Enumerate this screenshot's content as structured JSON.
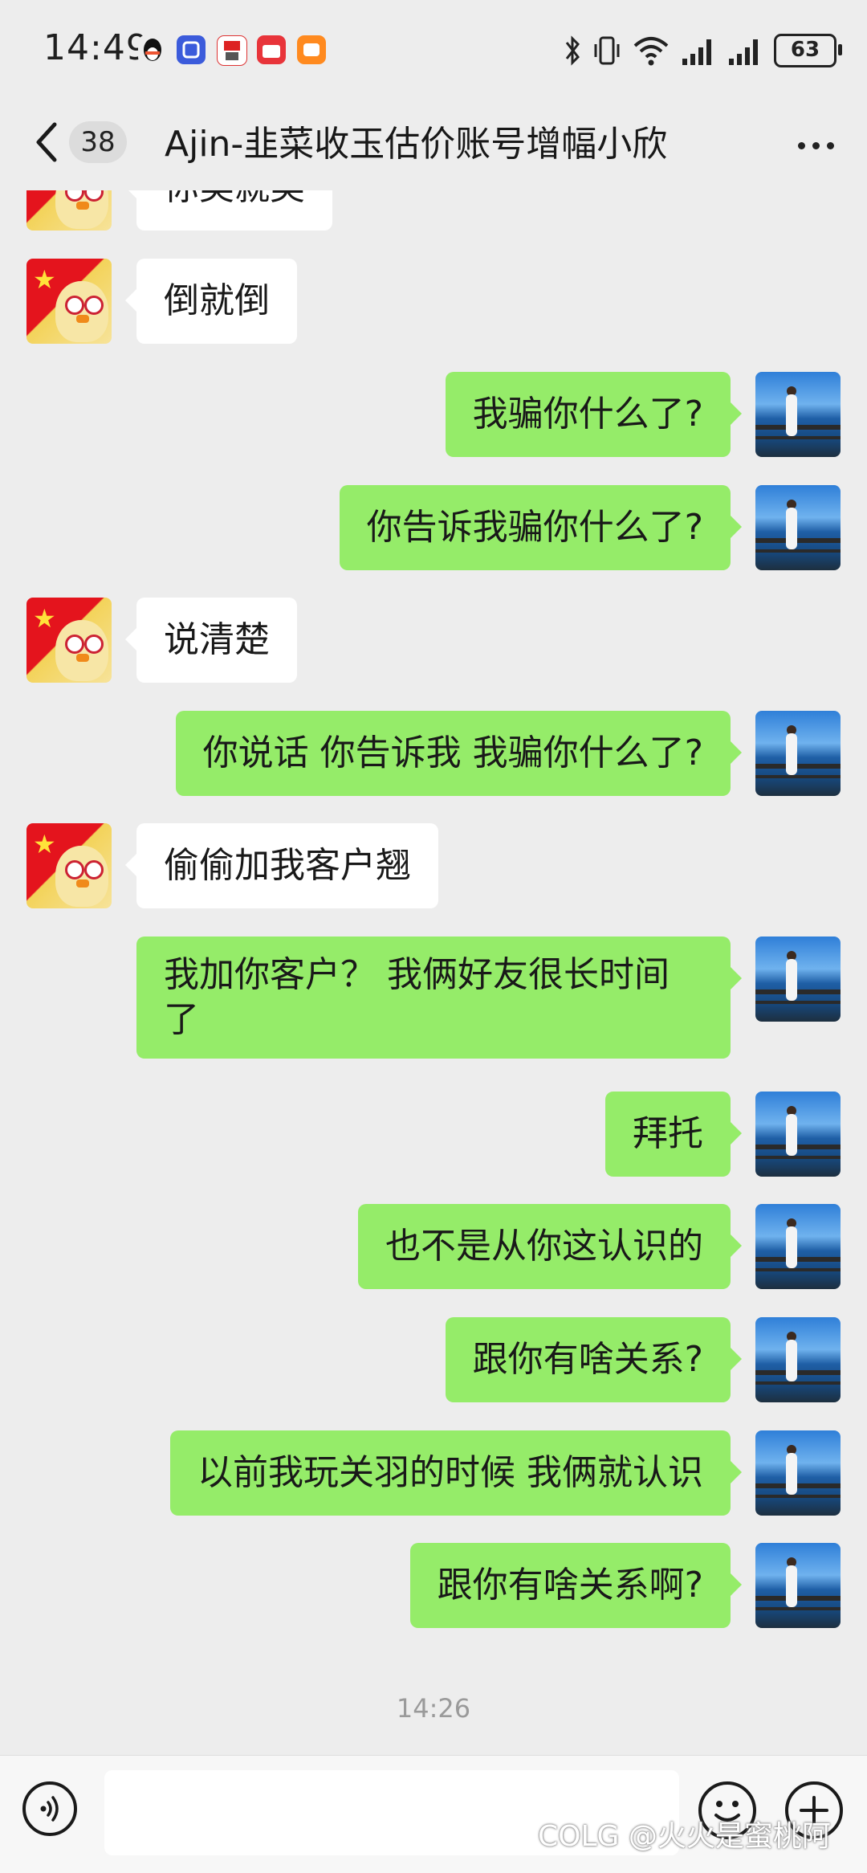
{
  "status_bar": {
    "time": "14:49",
    "battery": "63",
    "app_icons": [
      "qq-icon",
      "tieba-icon",
      "kfc-coffee-icon",
      "waimai-icon",
      "orange-app-icon"
    ],
    "right_icons": [
      "bluetooth-icon",
      "vibrate-icon",
      "wifi-icon",
      "signal-icon",
      "signal-icon"
    ]
  },
  "header": {
    "unread_count": "38",
    "title": "Ajin-韭菜收玉估价账号增幅小欣"
  },
  "messages": [
    {
      "side": "left",
      "text": "你美就美"
    },
    {
      "side": "left",
      "text": "倒就倒"
    },
    {
      "side": "right",
      "text": "我骗你什么了?"
    },
    {
      "side": "right",
      "text": "你告诉我骗你什么了?"
    },
    {
      "side": "left",
      "text": "说清楚"
    },
    {
      "side": "right",
      "text": "你说话 你告诉我 我骗你什么了?"
    },
    {
      "side": "left",
      "text": "偷偷加我客户翘"
    },
    {
      "side": "right",
      "text": "我加你客户？ 我俩好友很长时间了"
    },
    {
      "side": "right",
      "text": "拜托"
    },
    {
      "side": "right",
      "text": "也不是从你这认识的"
    },
    {
      "side": "right",
      "text": "跟你有啥关系?"
    },
    {
      "side": "right",
      "text": "以前我玩关羽的时候 我俩就认识"
    },
    {
      "side": "right",
      "text": "跟你有啥关系啊?"
    }
  ],
  "timestamp": "14:26",
  "input": {
    "value": ""
  },
  "colors": {
    "background": "#ededed",
    "sent_bubble": "#95ec69",
    "received_bubble": "#ffffff"
  },
  "watermark": "COLG @火火是蜜桃阿"
}
